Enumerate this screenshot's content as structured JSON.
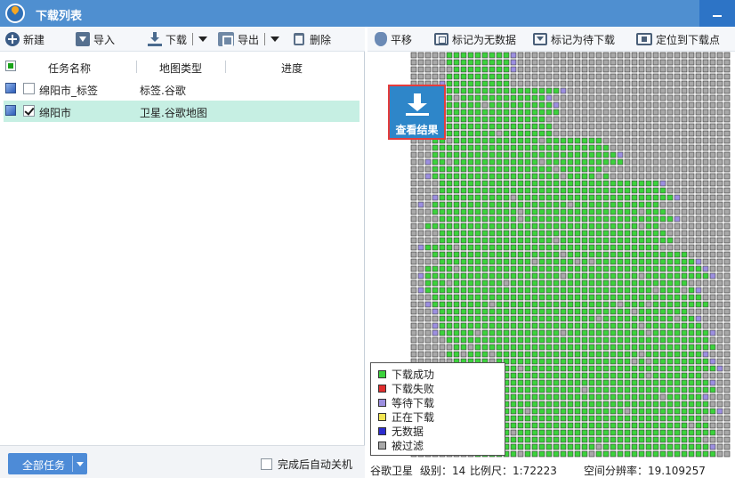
{
  "window": {
    "title": "下载列表"
  },
  "toolbar_left": {
    "new": "新建",
    "import": "导入",
    "download": "下载",
    "export": "导出",
    "delete": "删除"
  },
  "toolbar_right": {
    "pan": "平移",
    "mark_nodata": "标记为无数据",
    "mark_pending": "标记为待下载",
    "locate": "定位到下载点"
  },
  "table": {
    "headers": [
      "任务名称",
      "地图类型",
      "进度"
    ],
    "rows": [
      {
        "name": "绵阳市_标签",
        "type": "标签.谷歌",
        "checked": false,
        "selected": false
      },
      {
        "name": "绵阳市",
        "type": "卫星.谷歌地图",
        "checked": true,
        "selected": true
      }
    ]
  },
  "footer": {
    "all_tasks": "全部任务",
    "auto_shutdown": "完成后自动关机"
  },
  "view_result": "查看结果",
  "legend": [
    {
      "label": "下载成功",
      "color": "#3cd23c"
    },
    {
      "label": "下载失败",
      "color": "#e02d2d"
    },
    {
      "label": "等待下载",
      "color": "#9c8fe0"
    },
    {
      "label": "正在下载",
      "color": "#f2e552"
    },
    {
      "label": "无数据",
      "color": "#2c2ccf"
    },
    {
      "label": "被过滤",
      "color": "#a8a8a8"
    }
  ],
  "status": {
    "source": "谷歌卫星",
    "level": "级别：14",
    "scale": "比例尺：1:72223",
    "resolution": "空间分辨率：19.109257"
  },
  "colors": {
    "titlebar": "#4f8fd0",
    "selected_row": "#c6efe3",
    "tile_success": "#3cd23c",
    "tile_filtered": "#a8a8a8",
    "tile_waiting": "#9c8fe0"
  }
}
